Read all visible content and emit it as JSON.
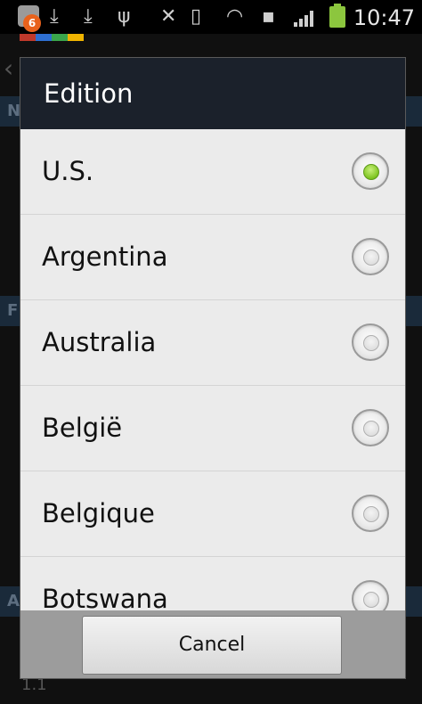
{
  "status_bar": {
    "notification_count": "6",
    "time": "10:47",
    "icons": [
      "notification-icon",
      "download-icon",
      "download-icon",
      "usb-icon",
      "mute-icon",
      "vibrate-icon",
      "wifi-icon",
      "sd-card-icon",
      "signal-icon",
      "battery-charging-icon"
    ],
    "battery_color": "#8cc63e",
    "badge_color": "#e8621c"
  },
  "background": {
    "section_letters": [
      "N",
      "F",
      "A"
    ],
    "bottom_text": "1.1"
  },
  "dialog": {
    "title": "Edition",
    "options": [
      {
        "label": "U.S.",
        "selected": true
      },
      {
        "label": "Argentina",
        "selected": false
      },
      {
        "label": "Australia",
        "selected": false
      },
      {
        "label": "België",
        "selected": false
      },
      {
        "label": "Belgique",
        "selected": false
      },
      {
        "label": "Botswana",
        "selected": false
      }
    ],
    "cancel_label": "Cancel",
    "header_color": "#1b212b",
    "accent_color": "#7ec420"
  }
}
